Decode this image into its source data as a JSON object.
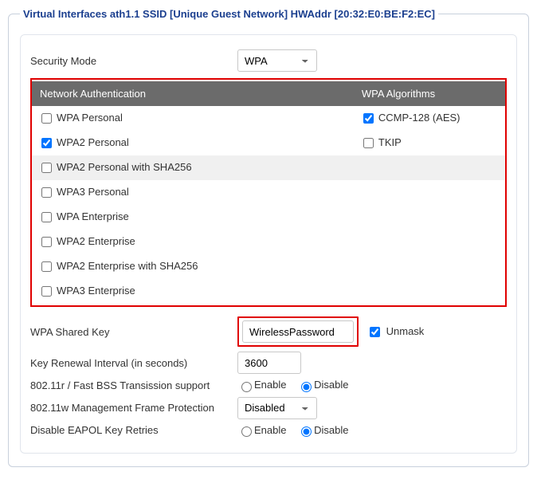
{
  "legend": "Virtual Interfaces ath1.1 SSID [Unique Guest Network] HWAddr [20:32:E0:BE:F2:EC]",
  "securityMode": {
    "label": "Security Mode",
    "value": "WPA"
  },
  "authTable": {
    "headers": {
      "left": "Network Authentication",
      "right": "WPA Algorithms"
    },
    "left": [
      {
        "label": "WPA Personal",
        "checked": false
      },
      {
        "label": "WPA2 Personal",
        "checked": true
      },
      {
        "label": "WPA2 Personal with SHA256",
        "checked": false
      },
      {
        "label": "WPA3 Personal",
        "checked": false
      },
      {
        "label": "WPA Enterprise",
        "checked": false
      },
      {
        "label": "WPA2 Enterprise",
        "checked": false
      },
      {
        "label": "WPA2 Enterprise with SHA256",
        "checked": false
      },
      {
        "label": "WPA3 Enterprise",
        "checked": false
      }
    ],
    "right": [
      {
        "label": "CCMP-128 (AES)",
        "checked": true
      },
      {
        "label": "TKIP",
        "checked": false
      }
    ]
  },
  "wpaKey": {
    "label": "WPA Shared Key",
    "value": "WirelessPassword",
    "unmaskLabel": "Unmask",
    "unmaskChecked": true
  },
  "keyRenewal": {
    "label": "Key Renewal Interval (in seconds)",
    "value": "3600"
  },
  "fastBss": {
    "label": "802.11r / Fast BSS Transission support",
    "enable": "Enable",
    "disable": "Disable",
    "value": "disable"
  },
  "mfp": {
    "label": "802.11w Management Frame Protection",
    "value": "Disabled"
  },
  "eapol": {
    "label": "Disable EAPOL Key Retries",
    "enable": "Enable",
    "disable": "Disable",
    "value": "disable"
  }
}
